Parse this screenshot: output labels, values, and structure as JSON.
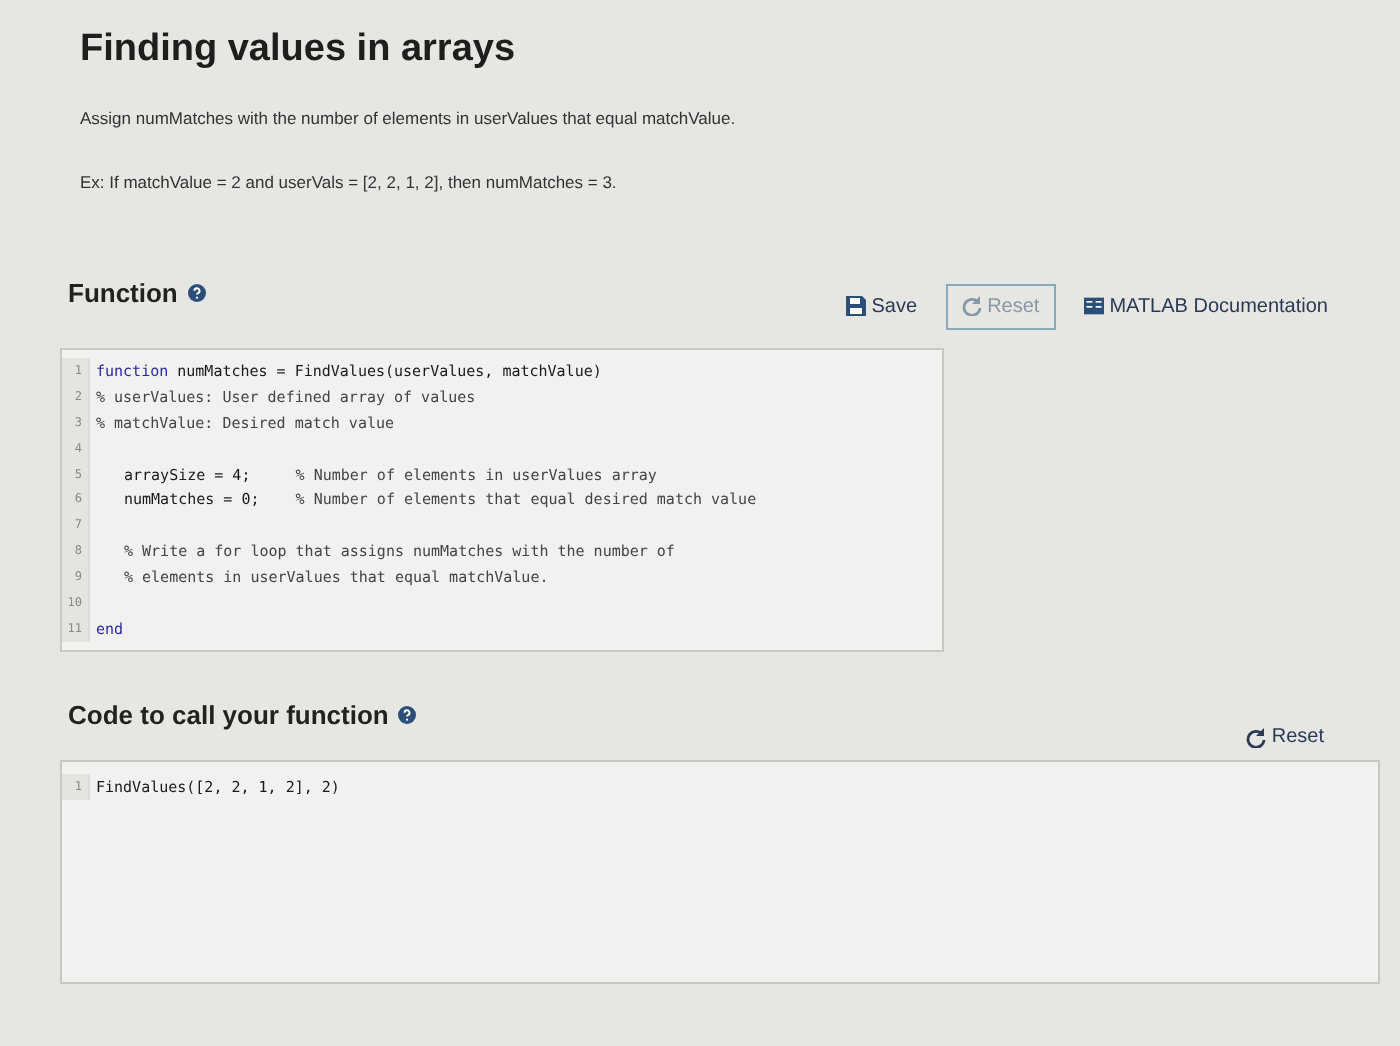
{
  "title": "Finding values in arrays",
  "description": "Assign numMatches with the number of elements in userValues that equal matchValue.",
  "example": "Ex: If matchValue = 2 and userVals = [2, 2, 1, 2], then numMatches = 3.",
  "function_section": {
    "heading": "Function",
    "toolbar": [
      {
        "kind": "save",
        "label": "Save",
        "disabled": false
      },
      {
        "kind": "reset",
        "label": "Reset",
        "disabled": true
      },
      {
        "kind": "docs",
        "label": "MATLAB Documentation",
        "disabled": false
      }
    ],
    "editor": {
      "lines": [
        {
          "number": "1",
          "indented": false,
          "segments": [
            {
              "kind": "keyword",
              "text": "function"
            },
            {
              "kind": "plain",
              "text": " numMatches = FindValues(userValues, matchValue)"
            }
          ]
        },
        {
          "number": "2",
          "indented": false,
          "segments": [
            {
              "kind": "comment",
              "text": "% userValues: User defined array of values"
            }
          ]
        },
        {
          "number": "3",
          "indented": false,
          "segments": [
            {
              "kind": "comment",
              "text": "% matchValue: Desired match value"
            }
          ]
        },
        {
          "number": "4"
        },
        {
          "number": "5",
          "indented": true,
          "segments": [
            {
              "kind": "plain",
              "text": "arraySize = 4;     "
            },
            {
              "kind": "comment",
              "text": "% Number of elements in userValues array"
            }
          ]
        },
        {
          "number": "6",
          "indented": true,
          "segments": [
            {
              "kind": "plain",
              "text": "numMatches = 0;    "
            },
            {
              "kind": "comment",
              "text": "% Number of elements that equal desired match value"
            }
          ]
        },
        {
          "number": "7"
        },
        {
          "number": "8",
          "indented": true,
          "segments": [
            {
              "kind": "comment",
              "text": "% Write a for loop that assigns numMatches with the number of"
            }
          ]
        },
        {
          "number": "9",
          "indented": true,
          "segments": [
            {
              "kind": "comment",
              "text": "% elements in userValues that equal matchValue."
            }
          ]
        },
        {
          "number": "10"
        },
        {
          "number": "11",
          "indented": false,
          "segments": [
            {
              "kind": "keyword",
              "text": "end"
            }
          ]
        }
      ]
    }
  },
  "call_section": {
    "heading": "Code to call your function",
    "reset": "Reset",
    "editor": {
      "lines": [
        {
          "number": "1",
          "segments": [
            {
              "kind": "plain",
              "text": "FindValues([2, 2, 1, 2], 2)"
            }
          ]
        }
      ]
    }
  }
}
